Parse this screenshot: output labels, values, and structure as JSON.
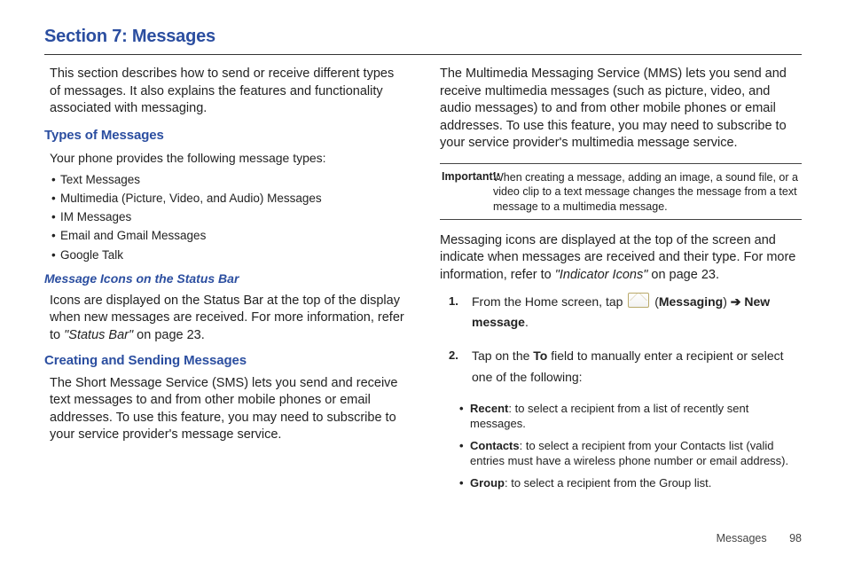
{
  "title": "Section 7: Messages",
  "left": {
    "intro": "This section describes how to send or receive different types of messages. It also explains the features and functionality associated with messaging.",
    "types_heading": "Types of Messages",
    "types_lead": "Your phone provides the following message types:",
    "types_list": {
      "i0": "Text Messages",
      "i1": "Multimedia (Picture, Video, and Audio) Messages",
      "i2": "IM Messages",
      "i3": "Email and Gmail Messages",
      "i4": "Google Talk"
    },
    "icons_heading": "Message Icons on the Status Bar",
    "icons_para_a": "Icons are displayed on the Status Bar at the top of the display when new messages are received. For more information, refer to ",
    "icons_xref": "\"Status Bar\" ",
    "icons_para_b": " on page 23.",
    "create_heading": "Creating and Sending Messages",
    "sms_para": "The Short Message Service (SMS) lets you send and receive text messages to and from other mobile phones or email addresses. To use this feature, you may need to subscribe to your service provider's message service."
  },
  "right": {
    "mms_para": "The Multimedia Messaging Service (MMS) lets you send and receive multimedia messages (such as picture, video, and audio messages) to and from other mobile phones or email addresses. To use this feature, you may need to subscribe to your service provider's multimedia message service.",
    "important_label": "Important!: ",
    "important_text": "When creating a message, adding an image, a sound file, or a video clip to a text message changes the message from a text message to a multimedia message.",
    "icons_para_a": "Messaging icons are displayed at the top of the screen and indicate when messages are received and their type. For more information, refer to ",
    "icons_xref": "\"Indicator Icons\" ",
    "icons_para_b": " on page 23.",
    "step1_a": "From the Home screen, tap ",
    "step1_b": " (",
    "step1_msg": "Messaging",
    "step1_c": ") ",
    "step1_arrow": "➔",
    "step1_d": " ",
    "step1_new": "New message",
    "step1_e": ".",
    "step2_a": "Tap on the ",
    "step2_to": "To",
    "step2_b": " field to manually enter a recipient or select one of the following:",
    "options": {
      "recent_label": "Recent",
      "recent_text": ": to select a recipient from a list of recently sent messages.",
      "contacts_label": "Contacts",
      "contacts_text": ": to select a recipient from your Contacts list (valid entries must have a wireless phone number or email address).",
      "group_label": "Group",
      "group_text": ": to select a recipient from the Group list."
    }
  },
  "footer": {
    "label": "Messages",
    "page": "98"
  }
}
